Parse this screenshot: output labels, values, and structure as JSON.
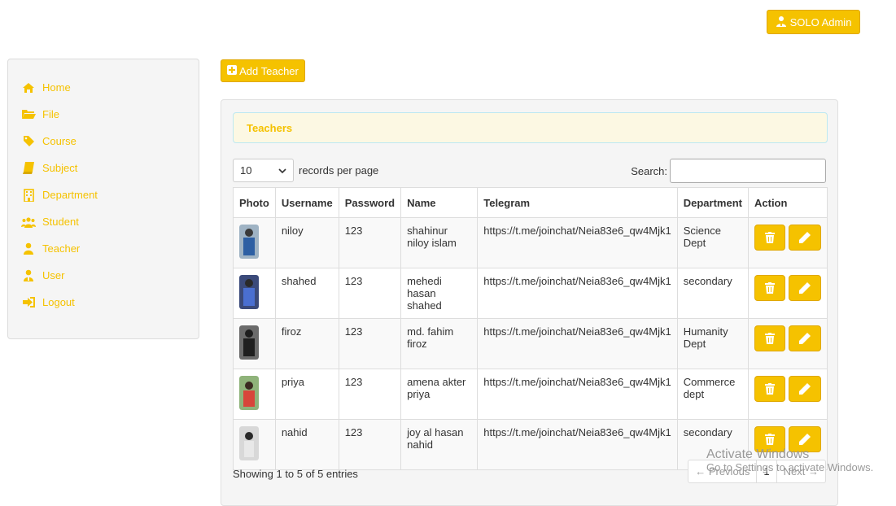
{
  "header": {
    "admin_label": "SOLO Admin"
  },
  "sidebar": {
    "items": [
      {
        "label": "Home",
        "icon": "home-icon"
      },
      {
        "label": "File",
        "icon": "folder-icon"
      },
      {
        "label": "Course",
        "icon": "tag-icon"
      },
      {
        "label": "Subject",
        "icon": "book-icon"
      },
      {
        "label": "Department",
        "icon": "building-icon"
      },
      {
        "label": "Student",
        "icon": "group-icon"
      },
      {
        "label": "Teacher",
        "icon": "person-icon"
      },
      {
        "label": "User",
        "icon": "user-tie-icon"
      },
      {
        "label": "Logout",
        "icon": "logout-icon"
      }
    ]
  },
  "toolbar": {
    "add_label": "Add Teacher"
  },
  "panel": {
    "title": "Teachers"
  },
  "table_controls": {
    "length_value": "10",
    "length_suffix": "records per page",
    "search_label": "Search:",
    "search_value": ""
  },
  "table": {
    "columns": [
      "Photo",
      "Username",
      "Password",
      "Name",
      "Telegram",
      "Department",
      "Action"
    ],
    "rows": [
      {
        "username": "niloy",
        "password": "123",
        "name": "shahinur niloy islam",
        "telegram": "https://t.me/joinchat/Neia83e6_qw4Mjk1",
        "department": "Science Dept"
      },
      {
        "username": "shahed",
        "password": "123",
        "name": "mehedi hasan shahed",
        "telegram": "https://t.me/joinchat/Neia83e6_qw4Mjk1",
        "department": "secondary"
      },
      {
        "username": "firoz",
        "password": "123",
        "name": "md. fahim firoz",
        "telegram": "https://t.me/joinchat/Neia83e6_qw4Mjk1",
        "department": "Humanity Dept"
      },
      {
        "username": "priya",
        "password": "123",
        "name": "amena akter priya",
        "telegram": "https://t.me/joinchat/Neia83e6_qw4Mjk1",
        "department": "Commerce dept"
      },
      {
        "username": "nahid",
        "password": "123",
        "name": "joy al hasan nahid",
        "telegram": "https://t.me/joinchat/Neia83e6_qw4Mjk1",
        "department": "secondary"
      }
    ]
  },
  "footer": {
    "info": "Showing 1 to 5 of 5 entries",
    "previous": "← Previous",
    "page": "1",
    "next": "Next →"
  },
  "watermark": {
    "title": "Activate Windows",
    "subtitle": "Go to Settings to activate Windows."
  },
  "colors": {
    "accent": "#f5c200",
    "panel_header_bg": "#fcf8e3"
  }
}
